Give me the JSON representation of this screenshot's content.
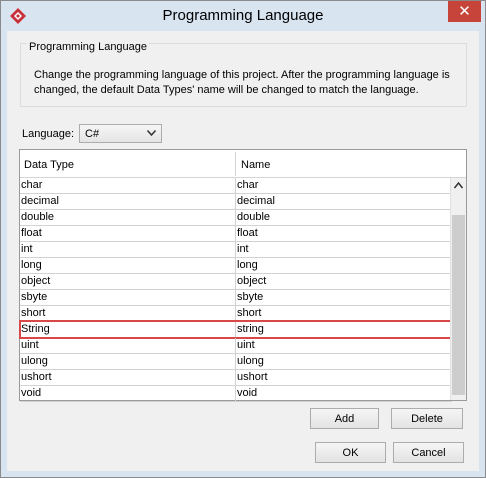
{
  "window": {
    "title": "Programming Language",
    "close_glyph": "✕"
  },
  "group": {
    "title": "Programming Language",
    "description": "Change the programming language of this project. After the programming language is changed, the default Data Types' name will be changed to match the language."
  },
  "language": {
    "label": "Language:",
    "selected": "C#"
  },
  "table": {
    "columns": [
      "Data Type",
      "Name"
    ],
    "rows": [
      {
        "data_type": "char",
        "name": "char"
      },
      {
        "data_type": "decimal",
        "name": "decimal"
      },
      {
        "data_type": "double",
        "name": "double"
      },
      {
        "data_type": "float",
        "name": "float"
      },
      {
        "data_type": "int",
        "name": "int"
      },
      {
        "data_type": "long",
        "name": "long"
      },
      {
        "data_type": "object",
        "name": "object"
      },
      {
        "data_type": "sbyte",
        "name": "sbyte"
      },
      {
        "data_type": "short",
        "name": "short"
      },
      {
        "data_type": "String",
        "name": "string"
      },
      {
        "data_type": "uint",
        "name": "uint"
      },
      {
        "data_type": "ulong",
        "name": "ulong"
      },
      {
        "data_type": "ushort",
        "name": "ushort"
      },
      {
        "data_type": "void",
        "name": "void"
      }
    ],
    "highlighted_row": 9
  },
  "buttons": {
    "add": "Add",
    "delete": "Delete",
    "ok": "OK",
    "cancel": "Cancel"
  },
  "colors": {
    "titlebar": "#d9e4f1",
    "close_button": "#c7443a",
    "highlight_border": "#d94848",
    "app_icon": "#c8303a"
  },
  "icons": {
    "app": "app-diamond-icon",
    "close": "close-icon",
    "dropdown": "chevron-down-icon",
    "scroll_up": "chevron-up-icon"
  }
}
